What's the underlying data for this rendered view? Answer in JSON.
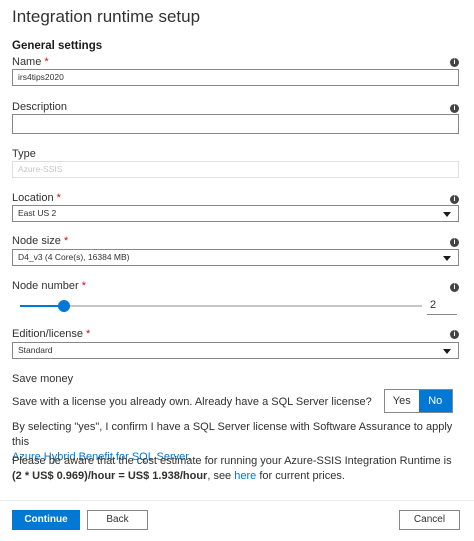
{
  "panel": {
    "title": "Integration runtime setup",
    "section": "General settings"
  },
  "name": {
    "label": "Name",
    "required": "*",
    "value": "irs4tips2020"
  },
  "description": {
    "label": "Description",
    "value": ""
  },
  "type": {
    "label": "Type",
    "value": "Azure-SSIS"
  },
  "location": {
    "label": "Location",
    "required": "*",
    "value": "East US 2"
  },
  "node_size": {
    "label": "Node size",
    "required": "*",
    "value": "D4_v3 (4 Core(s), 16384 MB)"
  },
  "node_number": {
    "label": "Node number",
    "required": "*",
    "value": "2",
    "slider_fraction": 0.11
  },
  "edition": {
    "label": "Edition/license",
    "required": "*",
    "value": "Standard"
  },
  "save_money": {
    "heading": "Save money",
    "question": "Save with a license you already own. Already have a SQL Server license?",
    "yes_label": "Yes",
    "no_label": "No",
    "confirm_text": "By selecting \"yes\", I confirm I have a SQL Server license with Software Assurance to apply this",
    "hybrid_link": "Azure Hybrid Benefit for SQL Server",
    "hybrid_suffix": "."
  },
  "cost": {
    "line1": "Please be aware that the cost estimate for running your Azure-SSIS Integration Runtime is",
    "line2_bold": "(2 * US$ 0.969)/hour = US$ 1.938/hour",
    "line2_mid": ", see ",
    "here_link": "here",
    "line2_end": " for current prices."
  },
  "footer": {
    "continue_label": "Continue",
    "back_label": "Back",
    "cancel_label": "Cancel"
  },
  "colors": {
    "accent": "#0078d4",
    "required": "#c50f1f"
  }
}
